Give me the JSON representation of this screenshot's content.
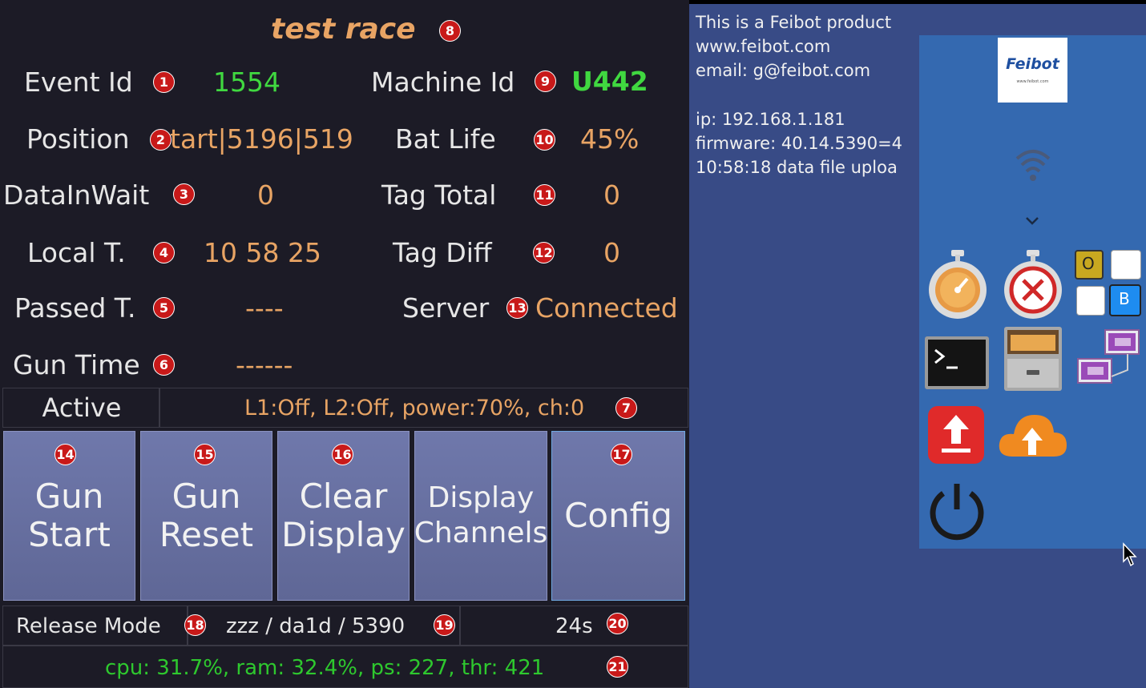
{
  "race_title": "test race",
  "fields": {
    "event_id": {
      "label": "Event Id",
      "value": "1554"
    },
    "machine_id": {
      "label": "Machine Id",
      "value": "U442"
    },
    "position": {
      "label": "Position",
      "value": "tart|5196|519"
    },
    "bat_life": {
      "label": "Bat Life",
      "value": "45%"
    },
    "data_in_wait": {
      "label": "DataInWait",
      "value": "0"
    },
    "tag_total": {
      "label": "Tag Total",
      "value": "0"
    },
    "local_time": {
      "label": "Local T.",
      "value": "10 58 25"
    },
    "tag_diff": {
      "label": "Tag Diff",
      "value": "0"
    },
    "passed_time": {
      "label": "Passed T.",
      "value": "----"
    },
    "server": {
      "label": "Server",
      "value": "Connected"
    },
    "gun_time": {
      "label": "Gun Time",
      "value": "------"
    }
  },
  "status": {
    "state": "Active",
    "reader": "L1:Off, L2:Off, power:70%, ch:0"
  },
  "buttons": {
    "gun_start": {
      "line1": "Gun",
      "line2": "Start"
    },
    "gun_reset": {
      "line1": "Gun",
      "line2": "Reset"
    },
    "clear_display": {
      "line1": "Clear",
      "line2": "Display"
    },
    "display_channels": {
      "line1": "Display",
      "line2": "Channels"
    },
    "config": {
      "line1": "Config"
    }
  },
  "footer": {
    "mode": "Release Mode",
    "version": "zzz / da1d / 5390",
    "countdown": "24s",
    "system": "cpu: 31.7%, ram: 32.4%, ps: 227, thr: 421"
  },
  "badges": [
    "1",
    "2",
    "3",
    "4",
    "5",
    "6",
    "7",
    "8",
    "9",
    "10",
    "11",
    "12",
    "13",
    "14",
    "15",
    "16",
    "17",
    "18",
    "19",
    "20",
    "21"
  ],
  "info": {
    "line1": "This is a Feibot product",
    "line2": "www.feibot.com",
    "line3": "email: g@feibot.com",
    "ip": "ip: 192.168.1.181",
    "firmware": "firmware: 40.14.5390=4",
    "upload": "10:58:18 data file uploa"
  },
  "logo": {
    "brand": "Feibot",
    "sub": "www.feibot.com"
  },
  "toggles": {
    "o": "O",
    "b": "B"
  },
  "colors": {
    "value_orange": "#e8a464",
    "value_green": "#40d840",
    "button": "#6a73a5",
    "panel_blue": "#3469b0",
    "badge_red": "#c81919"
  },
  "icons": [
    "wifi-icon",
    "chevron-down-icon",
    "stopwatch-icon",
    "stopwatch-cancel-icon",
    "terminal-icon",
    "file-cabinet-icon",
    "network-icon",
    "upload-icon",
    "cloud-upload-icon",
    "power-icon",
    "mouse-cursor-icon"
  ]
}
